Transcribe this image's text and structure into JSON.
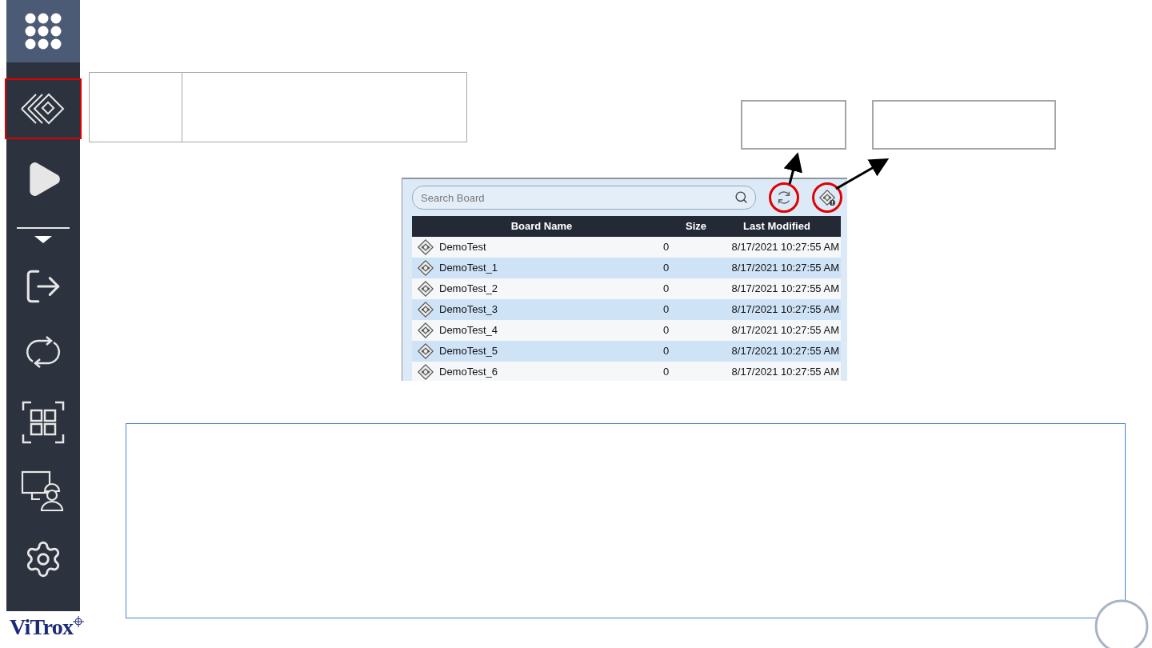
{
  "sidebar": {
    "items": [
      {
        "kind": "apps",
        "selected": true,
        "outlined": false
      },
      {
        "kind": "boards",
        "selected": false,
        "outlined": true
      },
      {
        "kind": "play",
        "selected": false,
        "outlined": false
      },
      {
        "kind": "expand",
        "selected": false,
        "outlined": false
      },
      {
        "kind": "exit",
        "selected": false,
        "outlined": false
      },
      {
        "kind": "cycle",
        "selected": false,
        "outlined": false
      },
      {
        "kind": "scan",
        "selected": false,
        "outlined": false
      },
      {
        "kind": "operator",
        "selected": false,
        "outlined": false
      },
      {
        "kind": "settings",
        "selected": false,
        "outlined": false
      }
    ]
  },
  "board_panel": {
    "search": {
      "placeholder": "Search Board"
    },
    "tools": [
      {
        "kind": "refresh",
        "circled": true
      },
      {
        "kind": "board-info",
        "circled": true
      }
    ],
    "table": {
      "columns": [
        "Board Name",
        "Size",
        "Last Modified"
      ],
      "rows": [
        {
          "name": "DemoTest",
          "size": "0",
          "modified": "8/17/2021 10:27:55 AM"
        },
        {
          "name": "DemoTest_1",
          "size": "0",
          "modified": "8/17/2021 10:27:55 AM"
        },
        {
          "name": "DemoTest_2",
          "size": "0",
          "modified": "8/17/2021 10:27:55 AM"
        },
        {
          "name": "DemoTest_3",
          "size": "0",
          "modified": "8/17/2021 10:27:55 AM"
        },
        {
          "name": "DemoTest_4",
          "size": "0",
          "modified": "8/17/2021 10:27:55 AM"
        },
        {
          "name": "DemoTest_5",
          "size": "0",
          "modified": "8/17/2021 10:27:55 AM"
        },
        {
          "name": "DemoTest_6",
          "size": "0",
          "modified": "8/17/2021 10:27:55 AM"
        }
      ]
    }
  },
  "logo": {
    "text": "ViTrox"
  }
}
